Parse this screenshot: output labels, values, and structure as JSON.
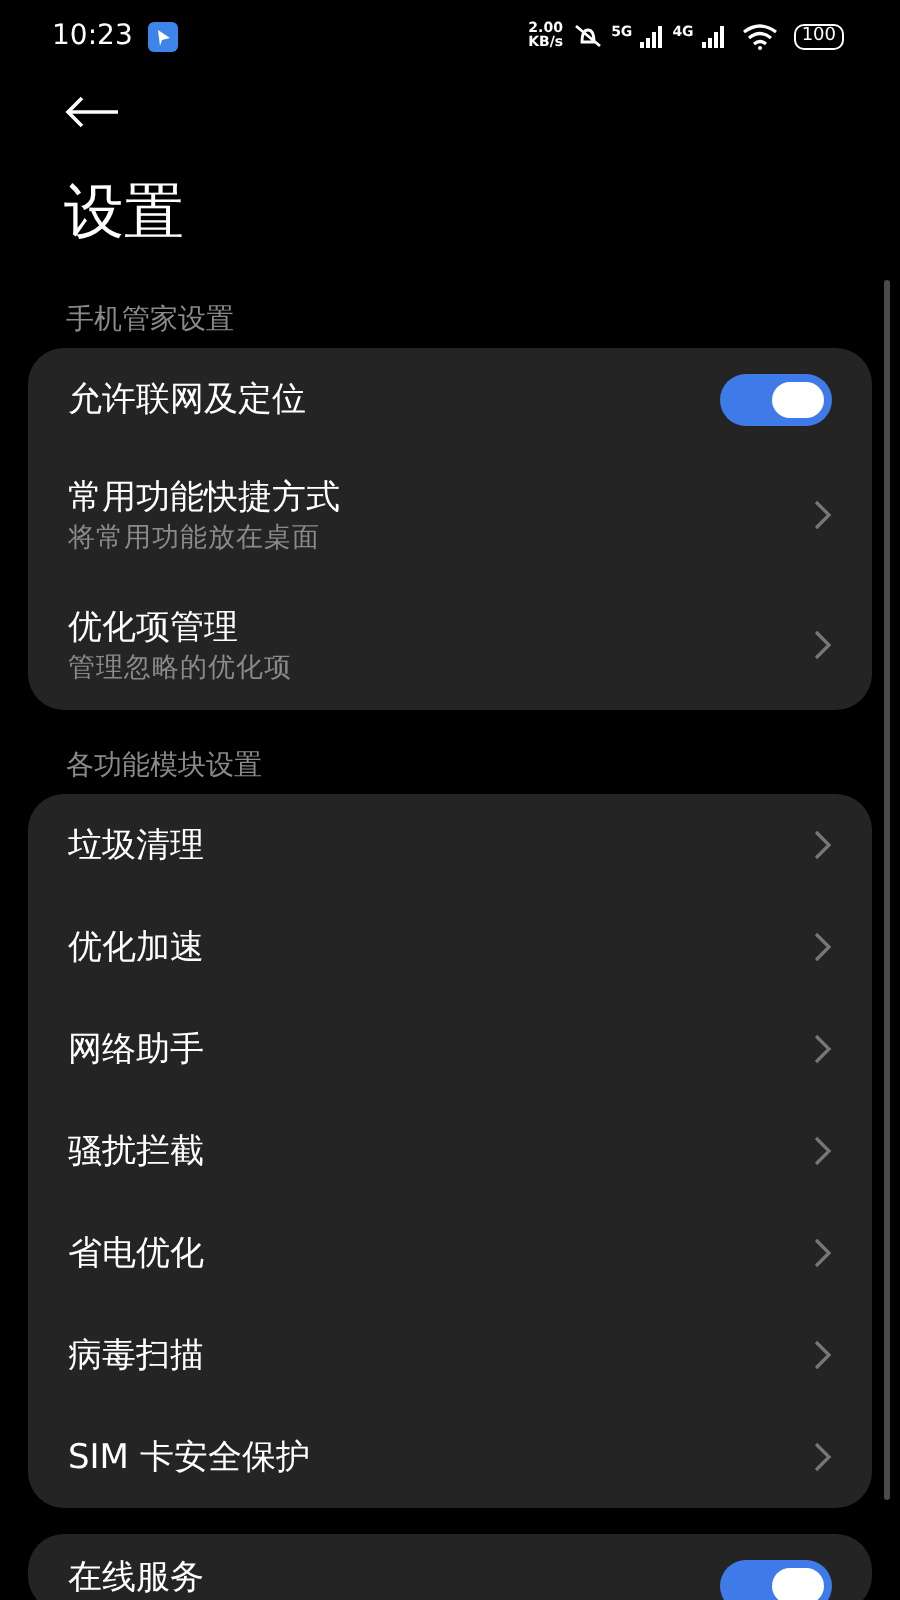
{
  "status_bar": {
    "time": "10:23",
    "speed_value": "2.00",
    "speed_unit": "KB/s",
    "sim1": "5G",
    "sim2": "4G",
    "battery": "100"
  },
  "title": "设置",
  "sections": [
    {
      "header": "手机管家设置",
      "items": [
        {
          "kind": "toggle",
          "label": "允许联网及定位",
          "on": true
        },
        {
          "kind": "link",
          "label": "常用功能快捷方式",
          "subtitle": "将常用功能放在桌面"
        },
        {
          "kind": "link",
          "label": "优化项管理",
          "subtitle": "管理忽略的优化项"
        }
      ]
    },
    {
      "header": "各功能模块设置",
      "items": [
        {
          "kind": "link",
          "label": "垃圾清理"
        },
        {
          "kind": "link",
          "label": "优化加速"
        },
        {
          "kind": "link",
          "label": "网络助手"
        },
        {
          "kind": "link",
          "label": "骚扰拦截"
        },
        {
          "kind": "link",
          "label": "省电优化"
        },
        {
          "kind": "link",
          "label": "病毒扫描"
        },
        {
          "kind": "link",
          "label": "SIM 卡安全保护"
        }
      ]
    },
    {
      "items": [
        {
          "kind": "toggle",
          "label": "在线服务",
          "on": true
        }
      ]
    }
  ]
}
